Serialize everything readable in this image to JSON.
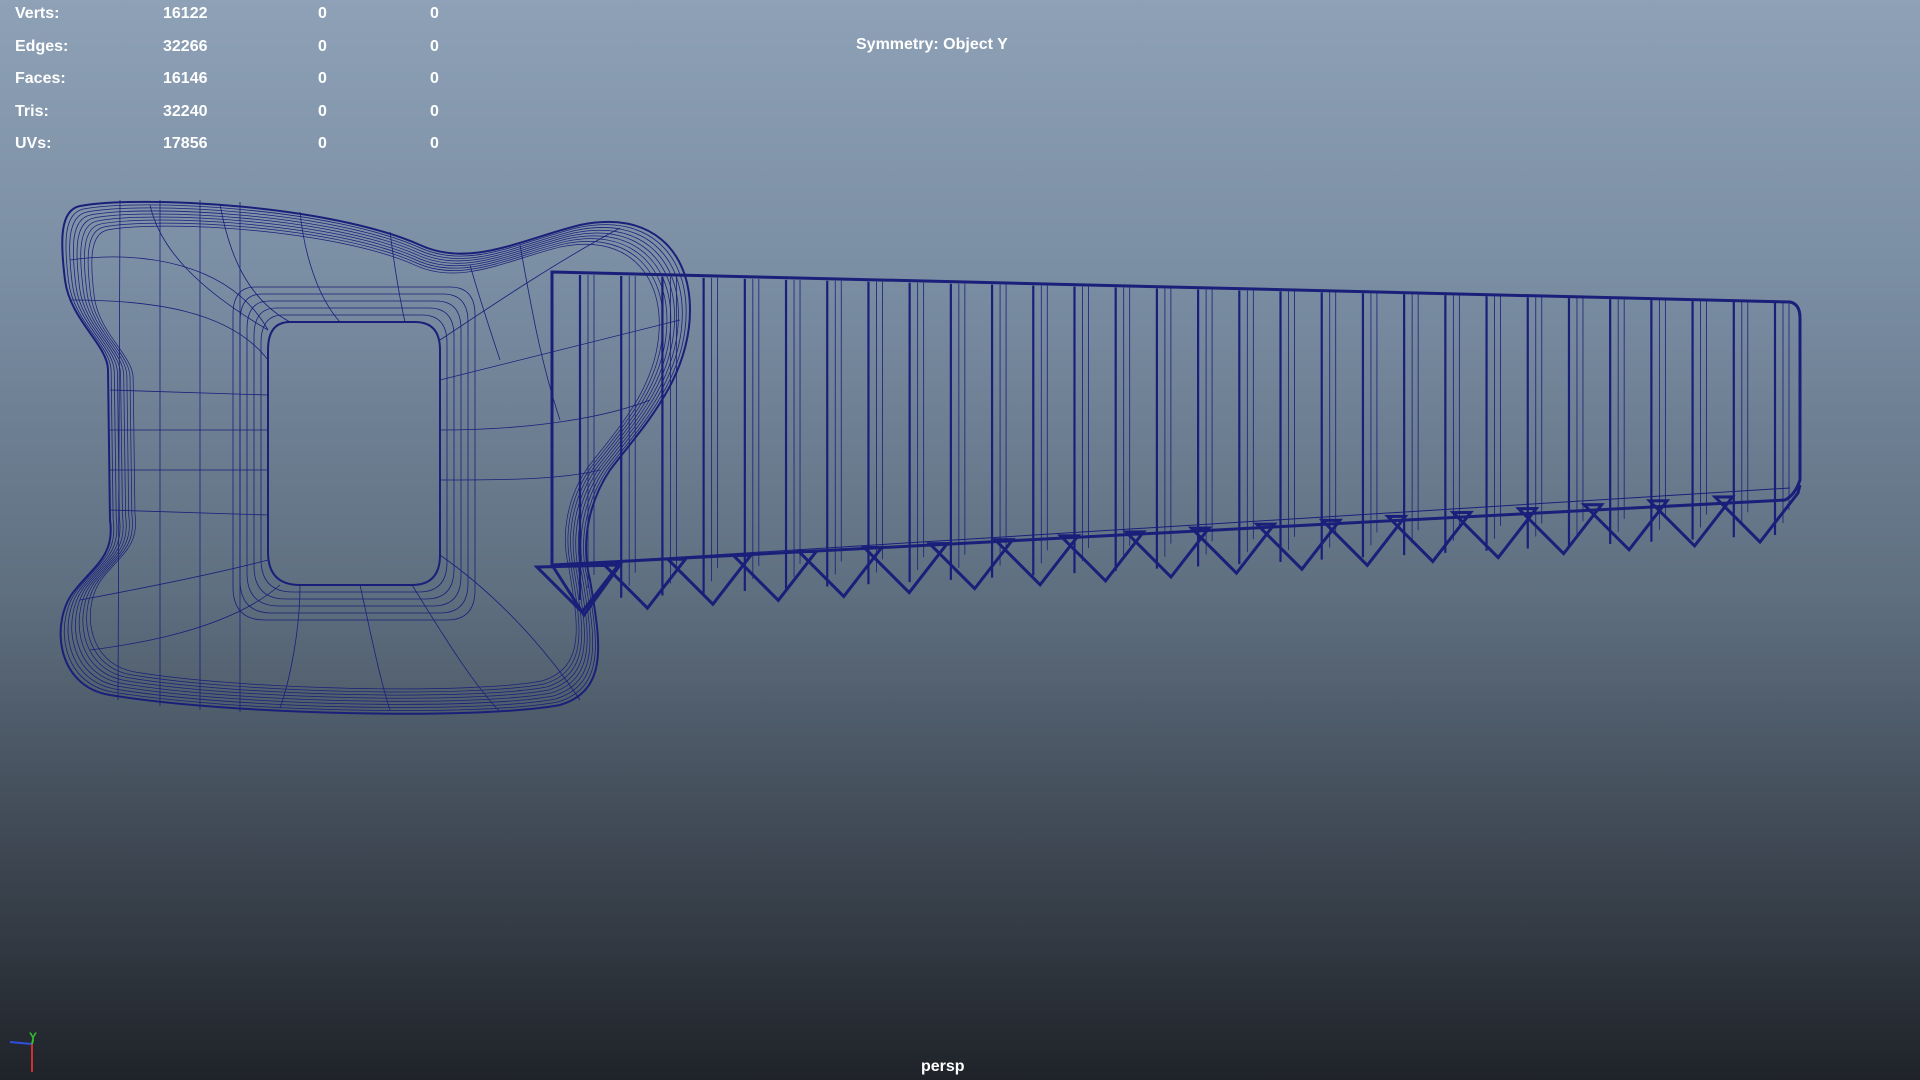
{
  "hud": {
    "rows": [
      {
        "label": "Verts:",
        "count": "16122",
        "sel1": "0",
        "sel2": "0"
      },
      {
        "label": "Edges:",
        "count": "32266",
        "sel1": "0",
        "sel2": "0"
      },
      {
        "label": "Faces:",
        "count": "16146",
        "sel1": "0",
        "sel2": "0"
      },
      {
        "label": "Tris:",
        "count": "32240",
        "sel1": "0",
        "sel2": "0"
      },
      {
        "label": "UVs:",
        "count": "17856",
        "sel1": "0",
        "sel2": "0"
      }
    ],
    "symmetry": "Symmetry: Object Y"
  },
  "viewport": {
    "camera": "persp",
    "model": "saw-wireframe",
    "wire_color": "#1a1f7a",
    "axis": {
      "y_label": "Y",
      "x_color": "#d23030",
      "y_color": "#30c030",
      "z_color": "#3050e0"
    }
  }
}
